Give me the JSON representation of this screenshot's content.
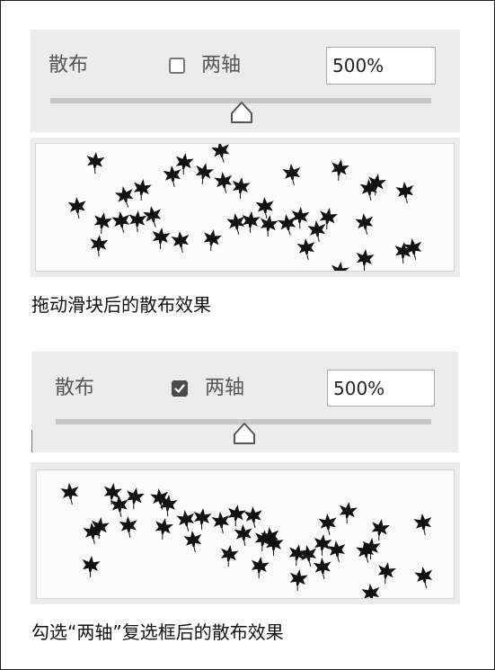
{
  "example1": {
    "scatter_label": "散布",
    "both_axes_label": "两轴",
    "both_axes_checked": false,
    "scatter_value": "500%",
    "slider_value_fraction": 0.5,
    "caption": "拖动滑块后的散布效果",
    "brush_icon": "maple-leaf-icon"
  },
  "example2": {
    "scatter_label": "散布",
    "both_axes_label": "两轴",
    "both_axes_checked": true,
    "scatter_value": "500%",
    "slider_value_fraction": 0.5,
    "caption": "勾选“两轴”复选框后的散布效果",
    "brush_icon": "maple-leaf-icon"
  },
  "colors": {
    "panel_bg": "#ececec",
    "track": "#c6c6c6",
    "leaf": "#111111"
  }
}
